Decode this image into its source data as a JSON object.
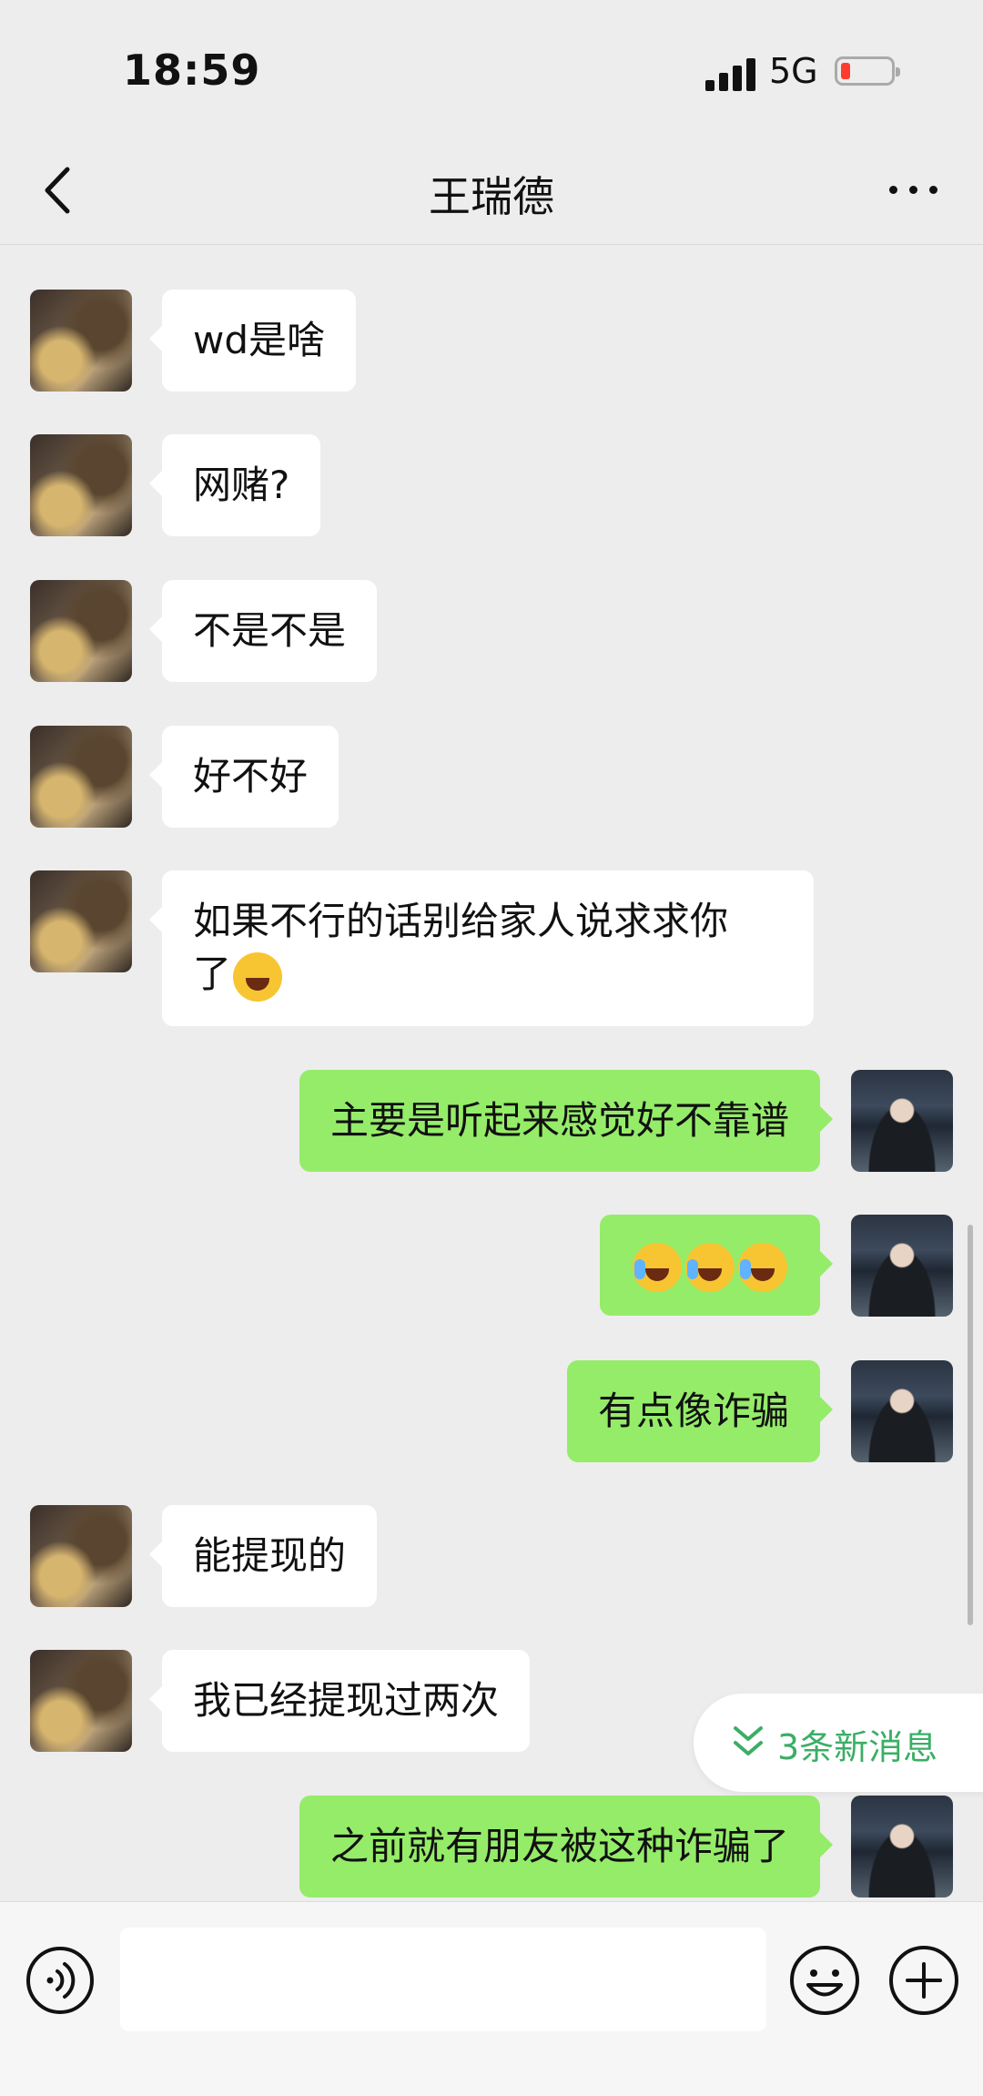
{
  "status": {
    "time": "18:59",
    "network": "5G"
  },
  "header": {
    "title": "王瑞德"
  },
  "messages": [
    {
      "from": "contact",
      "text": "wd是啥"
    },
    {
      "from": "contact",
      "text": "网赌?"
    },
    {
      "from": "contact",
      "text": "不是不是"
    },
    {
      "from": "contact",
      "text": "好不好"
    },
    {
      "from": "contact",
      "text_line1": "如果不行的话别给家人说求求你",
      "text_line2": "了",
      "emoji": "laughing-tears-emoji"
    },
    {
      "from": "me",
      "text": "主要是听起来感觉好不靠谱"
    },
    {
      "from": "me",
      "emoji": "facepalm-crying-emoji",
      "emoji_count": 3
    },
    {
      "from": "me",
      "text": "有点像诈骗"
    },
    {
      "from": "contact",
      "text": "能提现的"
    },
    {
      "from": "contact",
      "text": "我已经提现过两次"
    },
    {
      "from": "me",
      "text": "之前就有朋友被这种诈骗了"
    }
  ],
  "new_messages": {
    "label": "3条新消息",
    "icon": "double-chevron-down-icon"
  },
  "input": {
    "placeholder": ""
  },
  "icons": {
    "back": "chevron-left-icon",
    "more": "more-dots-icon",
    "voice": "voice-icon",
    "emoji": "smiley-icon",
    "plus": "plus-icon"
  },
  "colors": {
    "background": "#ededed",
    "bubble_me": "#95ec69",
    "bubble_contact": "#ffffff",
    "accent": "#3bae66",
    "battery_low": "#ff3b30"
  }
}
